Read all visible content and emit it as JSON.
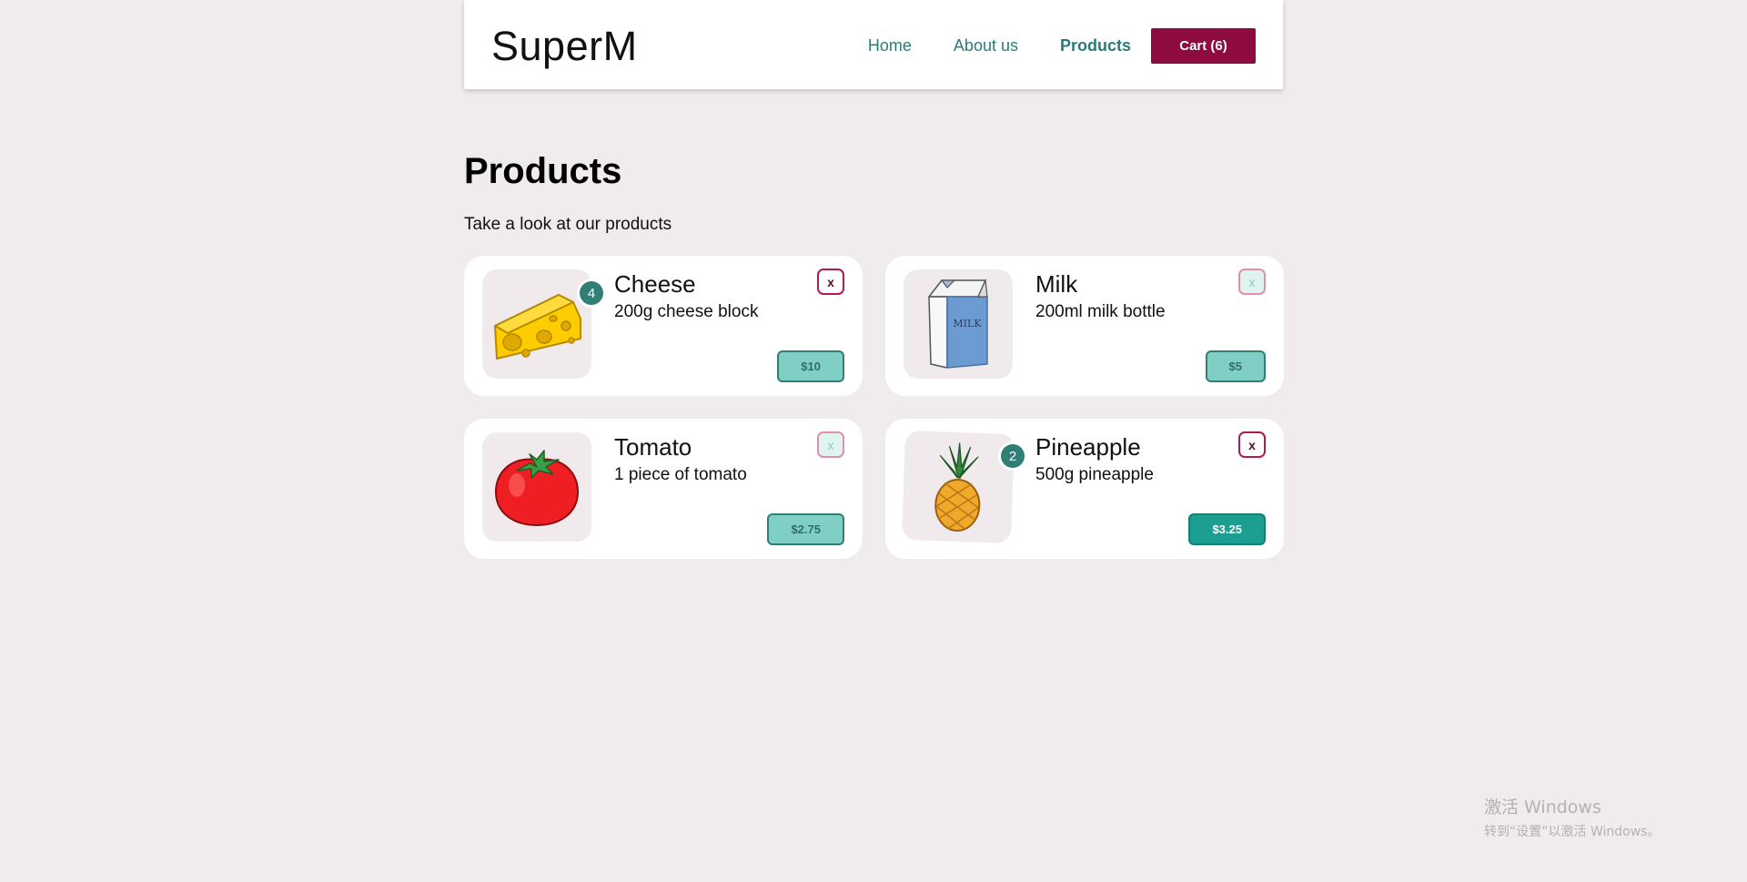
{
  "nav": {
    "logo": "SuperM",
    "links": [
      "Home",
      "About us",
      "Products"
    ],
    "active": "Products",
    "cart_label": "Cart (6)"
  },
  "page": {
    "title": "Products",
    "subtitle": "Take a look at our products"
  },
  "products": [
    {
      "name": "Cheese",
      "description": "200g cheese block",
      "price": "$10",
      "quantity": "4",
      "remove_label": "x",
      "image_icon": "cheese-icon"
    },
    {
      "name": "Milk",
      "description": "200ml milk bottle",
      "price": "$5",
      "remove_label": "x",
      "image_icon": "milk-carton-icon",
      "image_text": "MILK"
    },
    {
      "name": "Tomato",
      "description": "1 piece of tomato",
      "price": "$2.75",
      "remove_label": "x",
      "image_icon": "tomato-icon"
    },
    {
      "name": "Pineapple",
      "description": "500g pineapple",
      "price": "$3.25",
      "quantity": "2",
      "remove_label": "x",
      "image_icon": "pineapple-icon"
    }
  ],
  "watermark": {
    "title": "激活 Windows",
    "subtitle": "转到“设置”以激活 Windows。"
  },
  "colors": {
    "background": "#f0ebed",
    "brand": "#8e0b3f",
    "teal": "#2f7f77",
    "price_bg": "#80cfc5"
  }
}
